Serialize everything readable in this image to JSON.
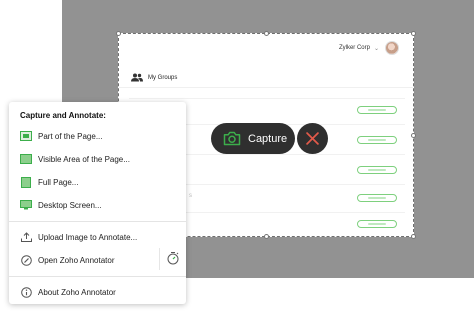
{
  "app": {
    "org_name": "Zylker Corp",
    "groups_label": "My Groups",
    "ghost_texts": [
      "...",
      "s"
    ]
  },
  "capture": {
    "capture_label": "Capture"
  },
  "menu": {
    "title": "Capture and Annotate:",
    "items": [
      {
        "label": "Part of the Page...",
        "icon": "part-page-icon"
      },
      {
        "label": "Visible Area of the Page...",
        "icon": "visible-area-icon"
      },
      {
        "label": "Full Page...",
        "icon": "full-page-icon"
      },
      {
        "label": "Desktop Screen...",
        "icon": "desktop-screen-icon"
      },
      {
        "label": "Upload Image to Annotate...",
        "icon": "upload-icon"
      },
      {
        "label": "Open Zoho Annotator",
        "icon": "annotator-icon"
      },
      {
        "label": "About Zoho Annotator",
        "icon": "info-icon"
      }
    ]
  },
  "colors": {
    "overlay": "#929292",
    "control_bg": "#2f2f2f",
    "accent_green": "#3cae4b",
    "cancel_red": "#e25a4a"
  }
}
